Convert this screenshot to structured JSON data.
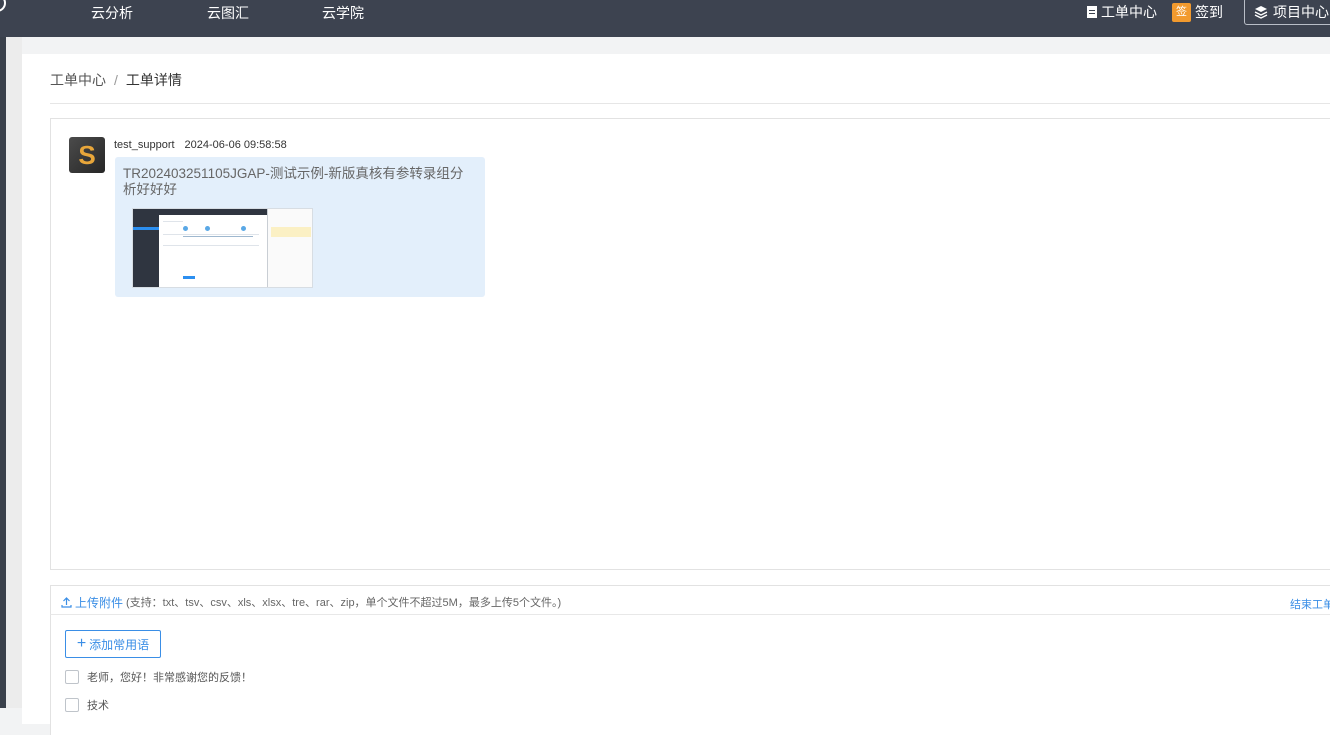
{
  "nav": {
    "items": [
      "云分析",
      "云图汇",
      "云学院"
    ],
    "ticket_center": "工单中心",
    "signin_badge": "签",
    "signin": "签到",
    "project_center": "项目中心"
  },
  "breadcrumb": {
    "root": "工单中心",
    "separator": "/",
    "current": "工单详情"
  },
  "message": {
    "avatar_letter": "S",
    "user": "test_support",
    "time": "2024-06-06 09:58:58",
    "text": "TR202403251105JGAP-测试示例-新版真核有参转录组分析好好好"
  },
  "reply": {
    "upload_label": "上传附件",
    "upload_note": "(支持：txt、tsv、csv、xls、xlsx、tre、rar、zip，单个文件不超过5M，最多上传5个文件。)",
    "end_ticket": "结束工单",
    "add_phrase": "添加常用语",
    "phrases": [
      "老师，您好！非常感谢您的反馈！",
      "技术"
    ]
  },
  "colors": {
    "topbar": "#3d4350",
    "accent": "#3a8ee6",
    "bubble": "#e3effb",
    "badge": "#f29a2e"
  }
}
